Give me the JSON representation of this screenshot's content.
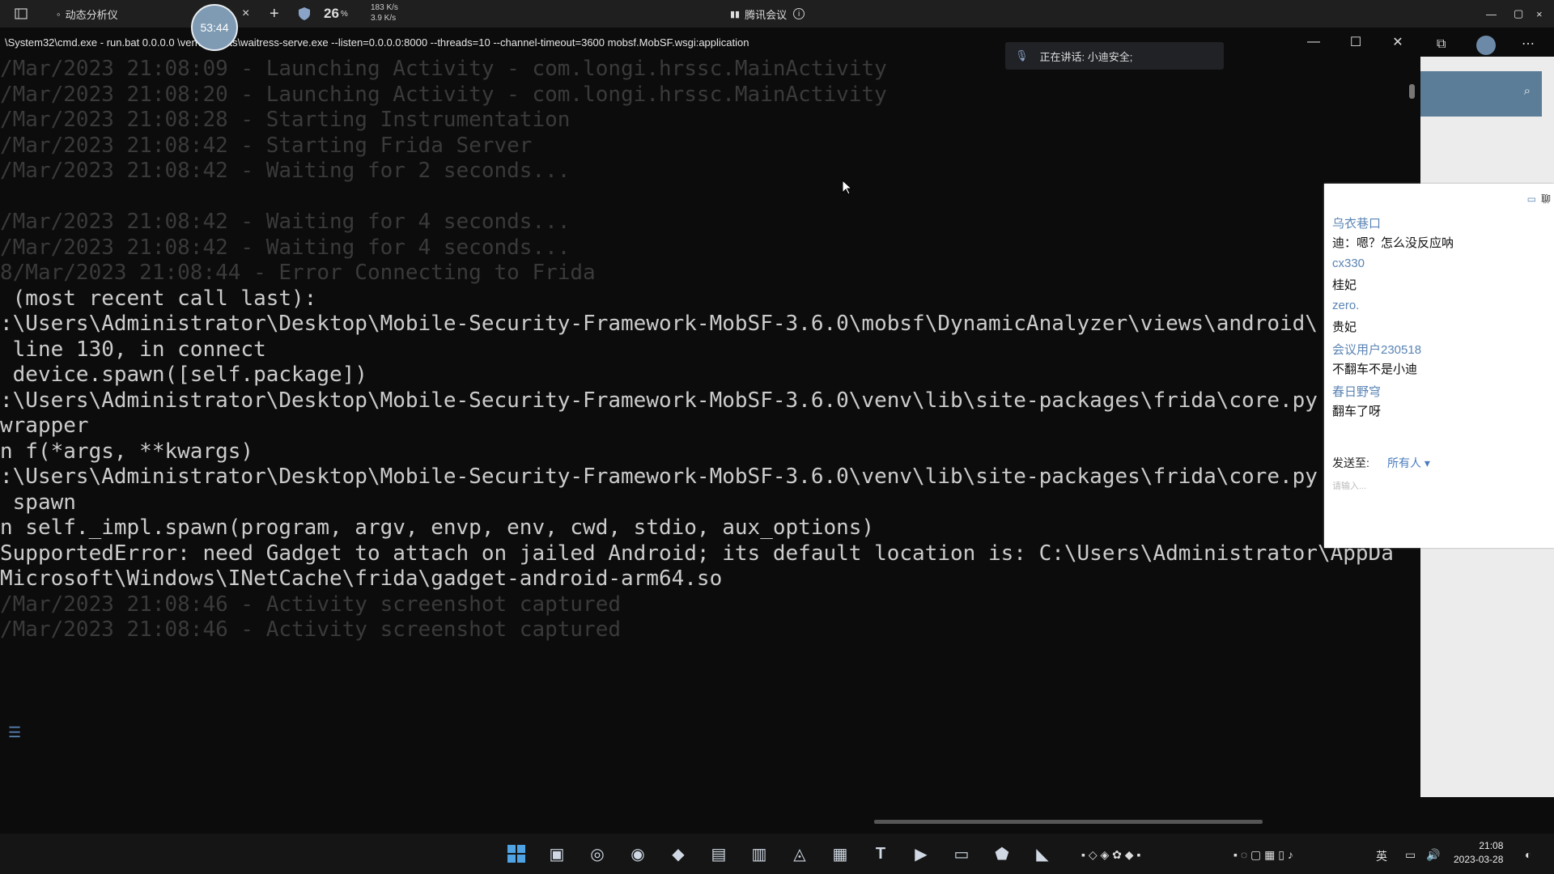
{
  "top_bar": {
    "tab_title": "动态分析仪",
    "timer": "53:44",
    "temp_value": "26",
    "temp_unit": "%",
    "net_up": "183 K/s",
    "net_down": "3.9 K/s",
    "meeting_title": "腾讯会议"
  },
  "console_window": {
    "title": "\\System32\\cmd.exe - run.bat  0.0.0.0    \\venv\\Scripts\\waitress-serve.exe  --listen=0.0.0.0:8000  --threads=10  --channel-timeout=3600 mobsf.MobSF.wsgi:application",
    "speaking_label": "正在讲话: 小迪安全;",
    "lines": [
      {
        "text": "/Mar/2023 21:08:09 - Launching Activity - com.longi.hrssc.MainActivity",
        "style": "faded"
      },
      {
        "text": "/Mar/2023 21:08:20 - Launching Activity - com.longi.hrssc.MainActivity",
        "style": "faded"
      },
      {
        "text": "/Mar/2023 21:08:28 - Starting Instrumentation",
        "style": "faded"
      },
      {
        "text": "/Mar/2023 21:08:42 - Starting Frida Server",
        "style": "faded"
      },
      {
        "text": "/Mar/2023 21:08:42 - Waiting for 2 seconds...",
        "style": "faded"
      },
      {
        "text": "",
        "style": "faded"
      },
      {
        "text": "/Mar/2023 21:08:42 - Waiting for 4 seconds...",
        "style": "faded"
      },
      {
        "text": "/Mar/2023 21:08:42 - Waiting for 4 seconds...",
        "style": "faded"
      },
      {
        "text": "8/Mar/2023 21:08:44 - Error Connecting to Frida",
        "style": "faded"
      },
      {
        "text": " (most recent call last):",
        "style": "bright"
      },
      {
        "text": ":\\Users\\Administrator\\Desktop\\Mobile-Security-Framework-MobSF-3.6.0\\mobsf\\DynamicAnalyzer\\views\\android\\",
        "style": "bright"
      },
      {
        "text": " line 130, in connect",
        "style": "bright"
      },
      {
        "text": " device.spawn([self.package])",
        "style": "bright"
      },
      {
        "text": ":\\Users\\Administrator\\Desktop\\Mobile-Security-Framework-MobSF-3.6.0\\venv\\lib\\site-packages\\frida\\core.py",
        "style": "bright"
      },
      {
        "text": "wrapper",
        "style": "bright"
      },
      {
        "text": "n f(*args, **kwargs)",
        "style": "bright"
      },
      {
        "text": ":\\Users\\Administrator\\Desktop\\Mobile-Security-Framework-MobSF-3.6.0\\venv\\lib\\site-packages\\frida\\core.py",
        "style": "bright"
      },
      {
        "text": " spawn",
        "style": "bright"
      },
      {
        "text": "n self._impl.spawn(program, argv, envp, env, cwd, stdio, aux_options)",
        "style": "bright"
      },
      {
        "text": "SupportedError: need Gadget to attach on jailed Android; its default location is: C:\\Users\\Administrator\\AppDa",
        "style": "bright"
      },
      {
        "text": "Microsoft\\Windows\\INetCache\\frida\\gadget-android-arm64.so",
        "style": "bright"
      },
      {
        "text": "/Mar/2023 21:08:46 - Activity screenshot captured",
        "style": "faded"
      },
      {
        "text": "/Mar/2023 21:08:46 - Activity screenshot captured",
        "style": "faded"
      }
    ]
  },
  "chat": {
    "header": "聊",
    "messages": [
      {
        "name": "乌衣巷口",
        "text": "迪：嗯？怎么没反应呐"
      },
      {
        "name": "cx330",
        "text": "桂妃"
      },
      {
        "name": "zero.",
        "text": "贵妃"
      },
      {
        "name": "会议用户230518",
        "text": "不翻车不是小迪"
      },
      {
        "name": "春日野穹",
        "text": "翻车了呀"
      }
    ],
    "send_to_label": "发送至:",
    "send_to_value": "所有人 ▾",
    "input_placeholder": "请输入..."
  },
  "taskbar": {
    "ime": "英",
    "time": "21:08",
    "date": "2023-03-28"
  },
  "colors": {
    "console_bg": "#0c0c0c",
    "chat_name": "#5a84b4",
    "meeting_blue": "#5b7d97"
  }
}
